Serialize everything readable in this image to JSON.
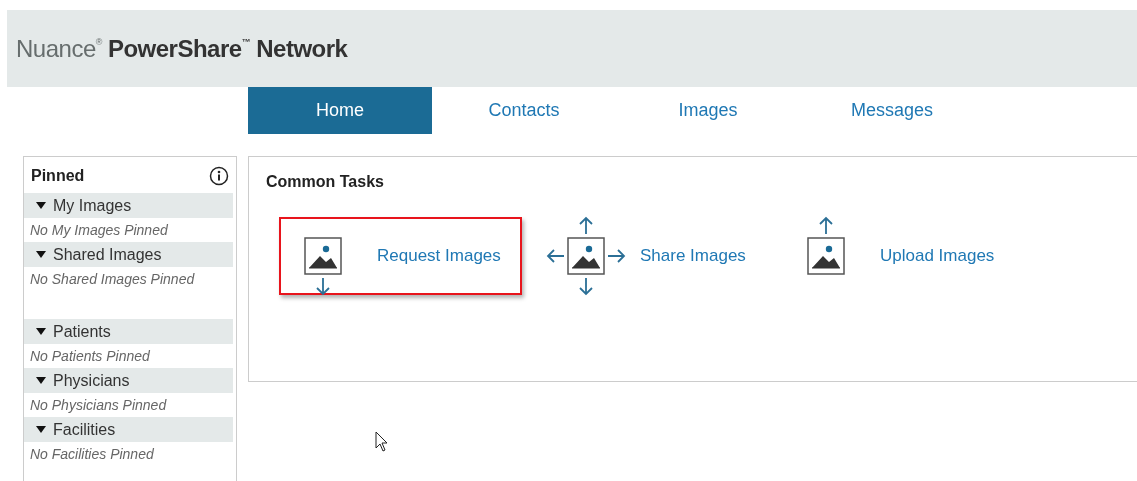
{
  "header": {
    "brand_light": "Nuance$^{®}$",
    "brand_bold": "PowerShare$^{™}$ Network"
  },
  "tabs": [
    {
      "label": "Home",
      "selected": true
    },
    {
      "label": "Contacts",
      "selected": false
    },
    {
      "label": "Images",
      "selected": false
    },
    {
      "label": "Messages",
      "selected": false
    }
  ],
  "sidebar": {
    "title": "Pinned",
    "sections": [
      {
        "title": "My Images",
        "expanded": true,
        "empty_text": "No My Images Pinned"
      },
      {
        "title": "Shared Images",
        "expanded": true,
        "empty_text": "No Shared Images Pinned"
      },
      {
        "title": "Patients",
        "expanded": true,
        "empty_text": "No Patients Pinned"
      },
      {
        "title": "Physicians",
        "expanded": true,
        "empty_text": "No Physicians Pinned"
      },
      {
        "title": "Facilities",
        "expanded": true,
        "empty_text": "No Facilities Pinned"
      }
    ]
  },
  "common_tasks": {
    "title": "Common Tasks",
    "tasks": [
      {
        "kind": "request",
        "label": "Request Images",
        "highlighted": true
      },
      {
        "kind": "share",
        "label": "Share Images",
        "highlighted": false
      },
      {
        "kind": "upload",
        "label": "Upload Images",
        "highlighted": false
      }
    ]
  }
}
